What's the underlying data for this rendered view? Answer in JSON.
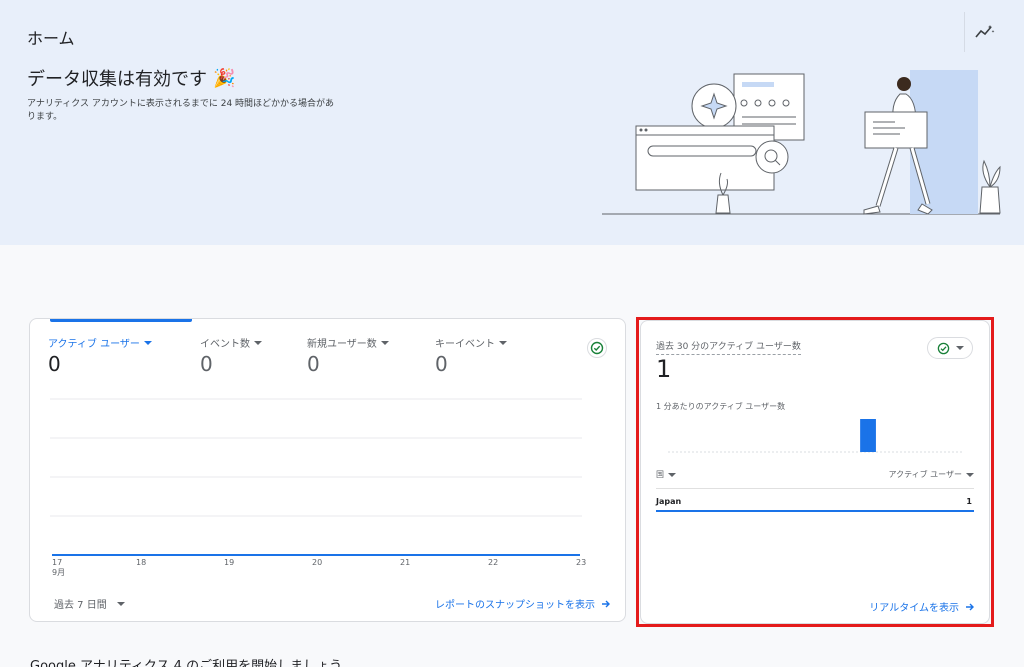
{
  "header": {
    "title": "ホーム",
    "headline": "データ収集は有効です",
    "headline_emoji": "🎉",
    "subtext": "アナリティクス アカウントに表示されるまでに 24 時間ほどかかる場合があります。",
    "insights_icon": "auto-graph-icon"
  },
  "overview": {
    "metrics": [
      {
        "label": "アクティブ ユーザー",
        "value": "0"
      },
      {
        "label": "イベント数",
        "value": "0"
      },
      {
        "label": "新規ユーザー数",
        "value": "0"
      },
      {
        "label": "キーイベント",
        "value": "0"
      }
    ],
    "date_range": "過去 7 日間",
    "snapshot_link": "レポートのスナップショットを表示"
  },
  "chart_data": {
    "type": "line",
    "x": [
      "17",
      "18",
      "19",
      "20",
      "21",
      "22",
      "23"
    ],
    "x_sublabel": "9月",
    "series": [
      {
        "values": [
          0,
          0,
          0,
          0,
          0,
          0,
          0
        ]
      }
    ],
    "grid": true
  },
  "realtime": {
    "title": "過去 30 分のアクティブ ユーザー数",
    "value": "1",
    "per_minute_label": "1 分あたりのアクティブ ユーザー数",
    "per_minute_values": [
      0,
      0,
      0,
      0,
      0,
      0,
      0,
      0,
      0,
      0,
      0,
      0,
      0,
      0,
      0,
      0,
      0,
      0,
      0,
      0,
      0,
      0,
      0,
      0,
      0,
      0,
      0,
      0,
      0,
      0,
      0,
      0,
      0,
      0,
      0,
      0,
      0,
      0,
      0,
      0,
      0,
      0,
      0,
      0,
      0,
      0,
      0,
      0,
      0,
      0,
      0,
      0,
      0,
      0,
      0,
      0,
      0,
      0,
      0,
      0,
      0,
      0,
      0,
      0,
      0,
      0,
      0,
      0,
      0,
      0,
      0,
      0,
      0,
      0,
      1,
      0,
      0,
      1,
      0,
      0,
      0,
      0,
      0,
      0,
      0,
      0,
      0,
      0,
      0,
      0,
      0,
      0,
      0,
      0,
      0,
      0,
      0,
      0,
      0,
      0,
      0,
      0,
      0,
      0,
      0,
      0,
      0,
      0,
      0,
      0,
      0,
      0,
      0,
      0
    ],
    "col_country": "国",
    "col_users": "アクティブ ユーザー",
    "rows": [
      {
        "country": "Japan",
        "users": "1"
      }
    ],
    "realtime_link": "リアルタイムを表示",
    "status_color": "#188038"
  },
  "bottom": {
    "heading": "Google アナリティクス 4 のご利用を開始しましょう"
  },
  "colors": {
    "accent": "#1a73e8",
    "highlight": "#e41b1b",
    "hero_bg": "#e8effa"
  }
}
